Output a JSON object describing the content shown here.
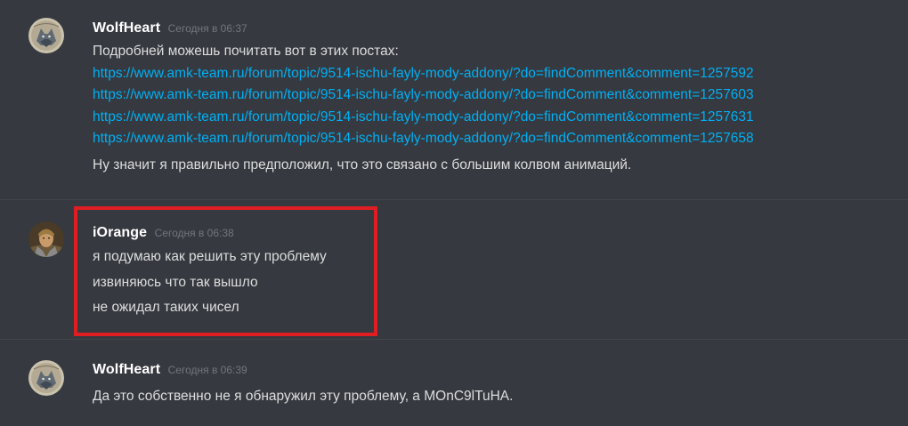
{
  "messages": [
    {
      "author": "WolfHeart",
      "timestamp": "Сегодня в 06:37",
      "lines": [
        "Подробней можешь почитать вот в этих постах:",
        "https://www.amk-team.ru/forum/topic/9514-ischu-fayly-mody-addony/?do=findComment&comment=1257592",
        "https://www.amk-team.ru/forum/topic/9514-ischu-fayly-mody-addony/?do=findComment&comment=1257603",
        "https://www.amk-team.ru/forum/topic/9514-ischu-fayly-mody-addony/?do=findComment&comment=1257631",
        "https://www.amk-team.ru/forum/topic/9514-ischu-fayly-mody-addony/?do=findComment&comment=1257658",
        "Ну значит я правильно предположил, что это связано с большим колвом анимаций."
      ]
    },
    {
      "author": "iOrange",
      "timestamp": "Сегодня в 06:38",
      "lines": [
        "я подумаю как решить эту проблему",
        "извиняюсь что так вышло",
        "не ожидал таких чисел"
      ]
    },
    {
      "author": "WolfHeart",
      "timestamp": "Сегодня в 06:39",
      "lines": [
        "Да это собственно не я обнаружил эту проблему, а MOnC9lTuHA."
      ]
    }
  ],
  "colors": {
    "background": "#36393f",
    "author": "#ffffff",
    "timestamp": "#72767d",
    "text": "#dcddde",
    "link": "#00b0f4",
    "highlight": "#e01e22"
  },
  "icons": {
    "wolfheart_avatar": "wolf-avatar-icon",
    "iorange_avatar": "knight-avatar-icon"
  }
}
